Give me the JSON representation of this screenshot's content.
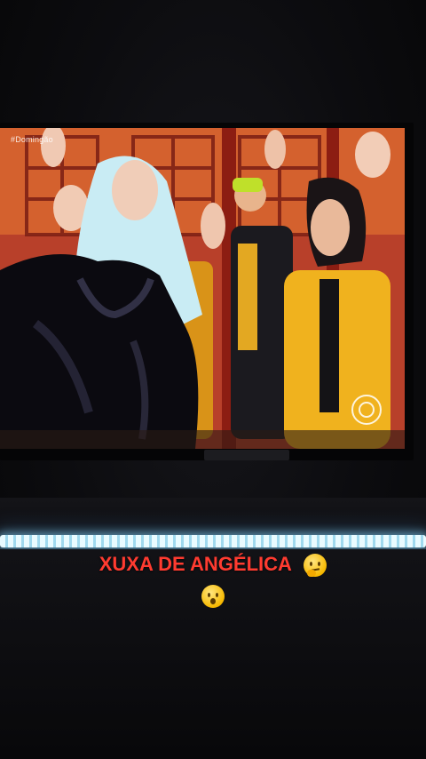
{
  "tv": {
    "hashtag": "#Domingão",
    "network_logo": "globo-logo-icon",
    "scene": "Performers dancing on stage in yellow and black jackets"
  },
  "story": {
    "caption_text": "XUXA DE ANGÉLICA",
    "caption_emoji": "thinking-face-emoji",
    "second_emoji": "hushed-face-emoji",
    "caption_color": "#ff3b30",
    "led_color": "#dff6ff"
  }
}
